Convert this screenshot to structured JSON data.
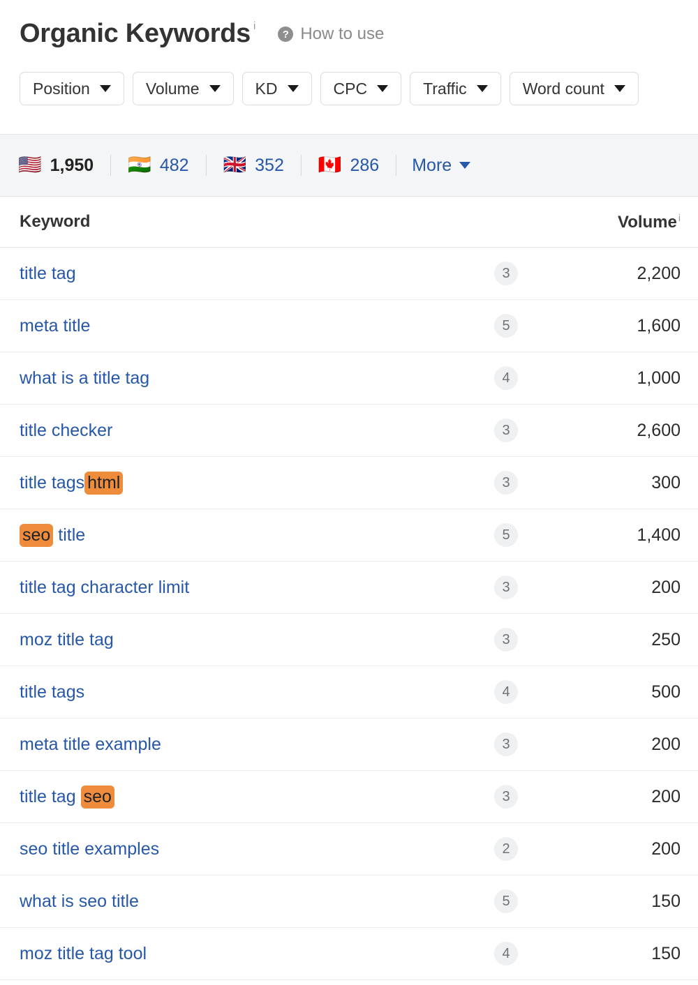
{
  "header": {
    "title": "Organic Keywords",
    "info_superscript": "i",
    "help": {
      "icon_label": "?",
      "label": "How to use"
    }
  },
  "filters": [
    {
      "label": "Position"
    },
    {
      "label": "Volume"
    },
    {
      "label": "KD"
    },
    {
      "label": "CPC"
    },
    {
      "label": "Traffic"
    },
    {
      "label": "Word count"
    }
  ],
  "countries": [
    {
      "flag": "🇺🇸",
      "name": "United States",
      "count": "1,950",
      "active": true
    },
    {
      "flag": "🇮🇳",
      "name": "India",
      "count": "482",
      "active": false
    },
    {
      "flag": "🇬🇧",
      "name": "United Kingdom",
      "count": "352",
      "active": false
    },
    {
      "flag": "🇨🇦",
      "name": "Canada",
      "count": "286",
      "active": false
    }
  ],
  "more_label": "More",
  "table": {
    "columns": {
      "keyword": "Keyword",
      "kd": "",
      "volume": "Volume",
      "volume_superscript": "i"
    },
    "rows": [
      {
        "parts": [
          {
            "text": "title tag",
            "highlight": false
          }
        ],
        "kd": "3",
        "volume": "2,200"
      },
      {
        "parts": [
          {
            "text": "meta title",
            "highlight": false
          }
        ],
        "kd": "5",
        "volume": "1,600"
      },
      {
        "parts": [
          {
            "text": "what is a title tag",
            "highlight": false
          }
        ],
        "kd": "4",
        "volume": "1,000"
      },
      {
        "parts": [
          {
            "text": "title checker",
            "highlight": false
          }
        ],
        "kd": "3",
        "volume": "2,600"
      },
      {
        "parts": [
          {
            "text": "title tags",
            "highlight": false
          },
          {
            "text": "html",
            "highlight": true
          }
        ],
        "kd": "3",
        "volume": "300"
      },
      {
        "parts": [
          {
            "text": "seo",
            "highlight": true
          },
          {
            "text": " title",
            "highlight": false
          }
        ],
        "kd": "5",
        "volume": "1,400"
      },
      {
        "parts": [
          {
            "text": "title tag character limit",
            "highlight": false
          }
        ],
        "kd": "3",
        "volume": "200"
      },
      {
        "parts": [
          {
            "text": "moz title tag",
            "highlight": false
          }
        ],
        "kd": "3",
        "volume": "250"
      },
      {
        "parts": [
          {
            "text": "title tags",
            "highlight": false
          }
        ],
        "kd": "4",
        "volume": "500"
      },
      {
        "parts": [
          {
            "text": "meta title example",
            "highlight": false
          }
        ],
        "kd": "3",
        "volume": "200"
      },
      {
        "parts": [
          {
            "text": "title tag ",
            "highlight": false
          },
          {
            "text": "seo",
            "highlight": true
          }
        ],
        "kd": "3",
        "volume": "200"
      },
      {
        "parts": [
          {
            "text": "seo title examples",
            "highlight": false
          }
        ],
        "kd": "2",
        "volume": "200"
      },
      {
        "parts": [
          {
            "text": "what is seo title",
            "highlight": false
          }
        ],
        "kd": "5",
        "volume": "150"
      },
      {
        "parts": [
          {
            "text": "moz title tag tool",
            "highlight": false
          }
        ],
        "kd": "4",
        "volume": "150"
      }
    ]
  },
  "colors": {
    "link_blue": "#2657a8",
    "highlight_orange": "#ef8c3c",
    "badge_bg": "#eff0f2",
    "country_bar_bg": "#f4f5f6"
  }
}
